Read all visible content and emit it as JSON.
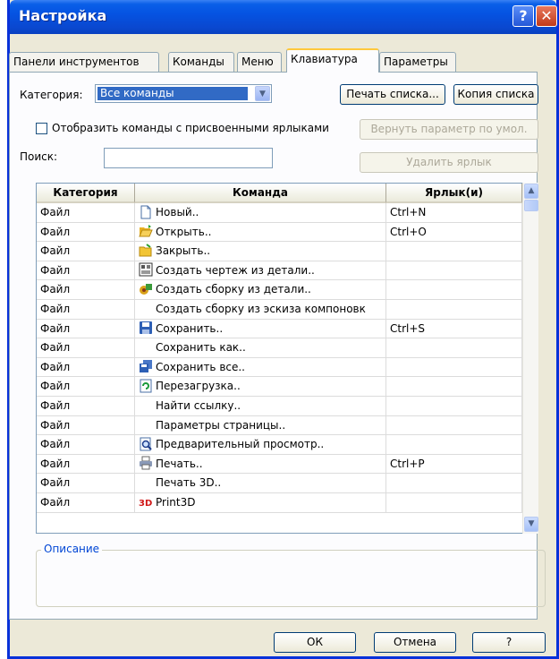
{
  "window": {
    "title": "Настройка",
    "help_glyph": "?",
    "close_glyph": "✕"
  },
  "tabs": [
    {
      "label": "Панели инструментов",
      "active": false
    },
    {
      "label": "Команды",
      "active": false
    },
    {
      "label": "Меню",
      "active": false
    },
    {
      "label": "Клавиатура",
      "active": true
    },
    {
      "label": "Параметры",
      "active": false
    }
  ],
  "filters": {
    "category_label": "Категория:",
    "category_value": "Все команды",
    "show_assigned_label": "Отобразить команды с присвоенными ярлыками",
    "show_assigned_checked": false,
    "search_label": "Поиск:",
    "search_value": ""
  },
  "actions": {
    "print_list": "Печать списка...",
    "copy_list": "Копия списка",
    "reset_default": "Вернуть параметр по умол.",
    "delete_shortcut": "Удалить ярлык"
  },
  "table": {
    "columns": [
      "Категория",
      "Команда",
      "Ярлык(и)"
    ],
    "rows": [
      {
        "category": "Файл",
        "command": "Новый..",
        "shortcut": "Ctrl+N",
        "icon": "new-document-icon"
      },
      {
        "category": "Файл",
        "command": "Открыть..",
        "shortcut": "Ctrl+O",
        "icon": "open-folder-icon"
      },
      {
        "category": "Файл",
        "command": "Закрыть..",
        "shortcut": "",
        "icon": "close-folder-icon"
      },
      {
        "category": "Файл",
        "command": "Создать чертеж из детали..",
        "shortcut": "",
        "icon": "drawing-from-part-icon"
      },
      {
        "category": "Файл",
        "command": "Создать сборку из детали..",
        "shortcut": "",
        "icon": "assembly-from-part-icon"
      },
      {
        "category": "Файл",
        "command": "Создать сборку из эскиза компоновк",
        "shortcut": "",
        "icon": ""
      },
      {
        "category": "Файл",
        "command": "Сохранить..",
        "shortcut": "Ctrl+S",
        "icon": "save-icon"
      },
      {
        "category": "Файл",
        "command": "Сохранить как..",
        "shortcut": "",
        "icon": ""
      },
      {
        "category": "Файл",
        "command": "Сохранить все..",
        "shortcut": "",
        "icon": "save-all-icon"
      },
      {
        "category": "Файл",
        "command": "Перезагрузка..",
        "shortcut": "",
        "icon": "reload-icon"
      },
      {
        "category": "Файл",
        "command": "Найти ссылку..",
        "shortcut": "",
        "icon": ""
      },
      {
        "category": "Файл",
        "command": "Параметры страницы..",
        "shortcut": "",
        "icon": ""
      },
      {
        "category": "Файл",
        "command": "Предварительный просмотр..",
        "shortcut": "",
        "icon": "print-preview-icon"
      },
      {
        "category": "Файл",
        "command": "Печать..",
        "shortcut": "Ctrl+P",
        "icon": "print-icon"
      },
      {
        "category": "Файл",
        "command": "Печать 3D..",
        "shortcut": "",
        "icon": ""
      },
      {
        "category": "Файл",
        "command": "Print3D",
        "shortcut": "",
        "icon": "print3d-icon"
      }
    ]
  },
  "description": {
    "label": "Описание"
  },
  "footer": {
    "ok": "ОК",
    "cancel": "Отмена",
    "help": "?"
  },
  "colors": {
    "titlebar": "#0553e2",
    "selection": "#316ac5",
    "active_tab_accent": "#ffc83c",
    "group_label": "#0046d5"
  }
}
